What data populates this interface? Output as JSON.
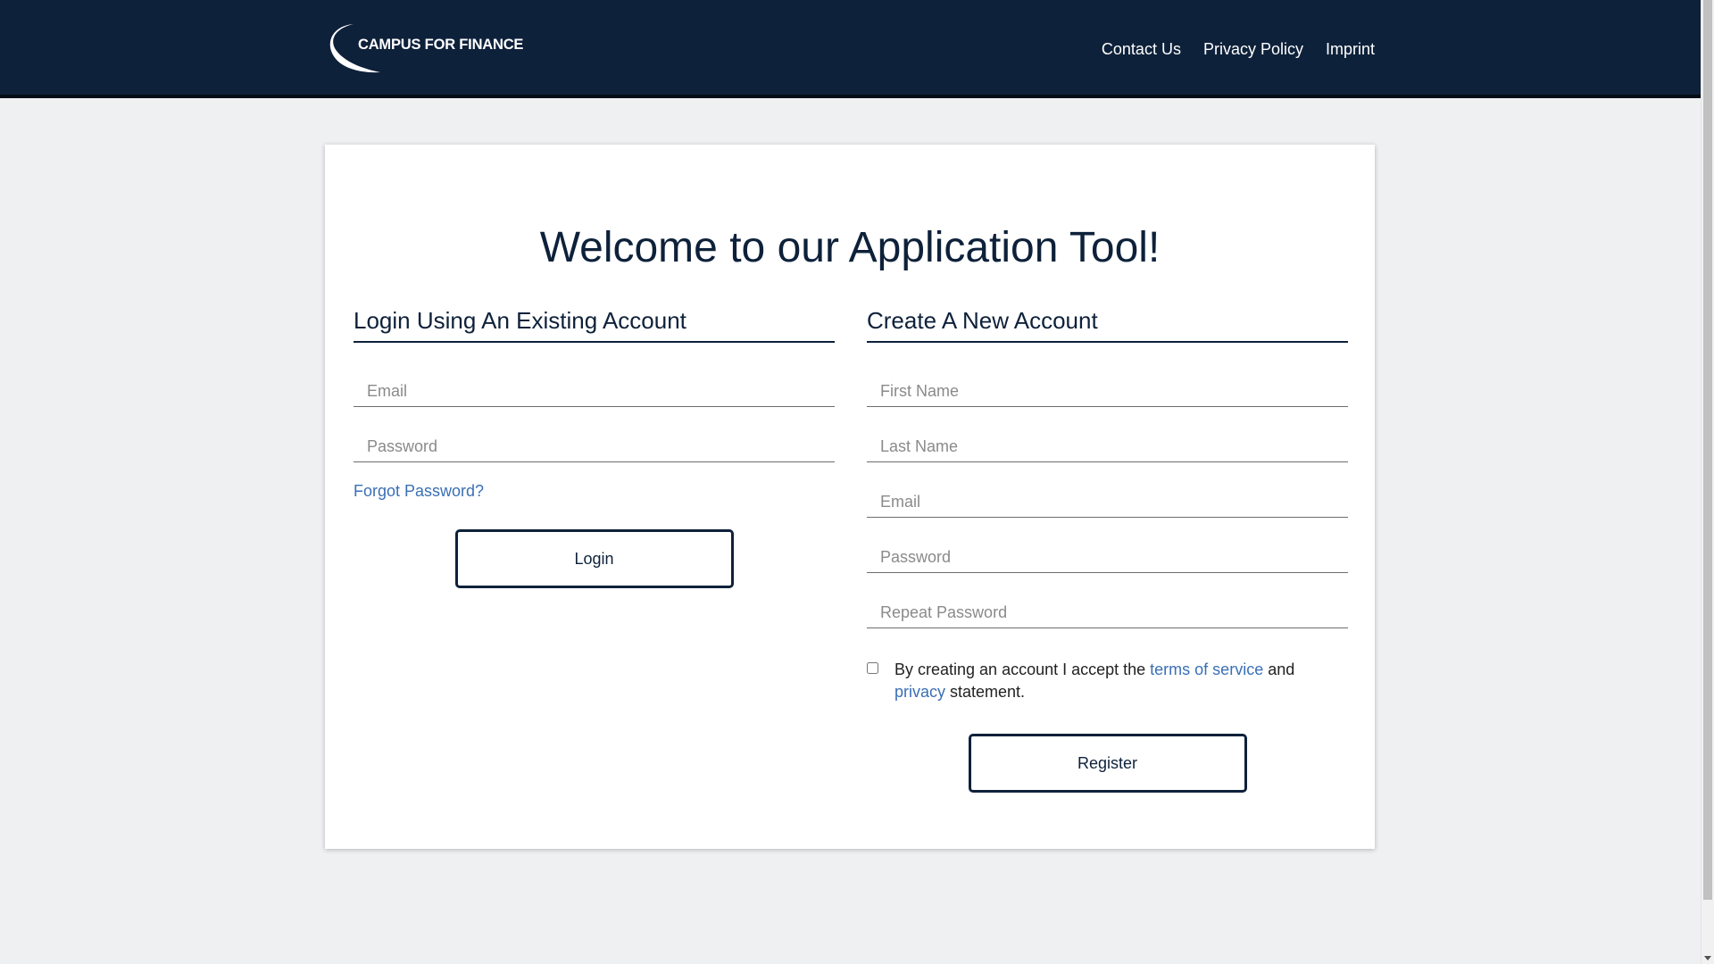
{
  "header": {
    "logo_text": "CAMPUS FOR FINANCE",
    "nav": [
      "Contact Us",
      "Privacy Policy",
      "Imprint"
    ]
  },
  "main": {
    "title": "Welcome to our Application Tool!",
    "login": {
      "heading": "Login Using An Existing Account",
      "email_placeholder": "Email",
      "password_placeholder": "Password",
      "forgot_label": "Forgot Password?",
      "button_label": "Login"
    },
    "register": {
      "heading": "Create A New Account",
      "first_name_placeholder": "First Name",
      "last_name_placeholder": "Last Name",
      "email_placeholder": "Email",
      "password_placeholder": "Password",
      "repeat_password_placeholder": "Repeat Password",
      "terms_prefix": "By creating an account I accept the ",
      "terms_link": "terms of service",
      "terms_middle": " and ",
      "privacy_link": "privacy",
      "terms_suffix": " statement.",
      "terms_checked": false,
      "button_label": "Register"
    }
  },
  "colors": {
    "header_bg": "#0e213a",
    "page_bg": "#eff0f2",
    "link": "#3a6fb5",
    "primary_text": "#0e213a"
  }
}
